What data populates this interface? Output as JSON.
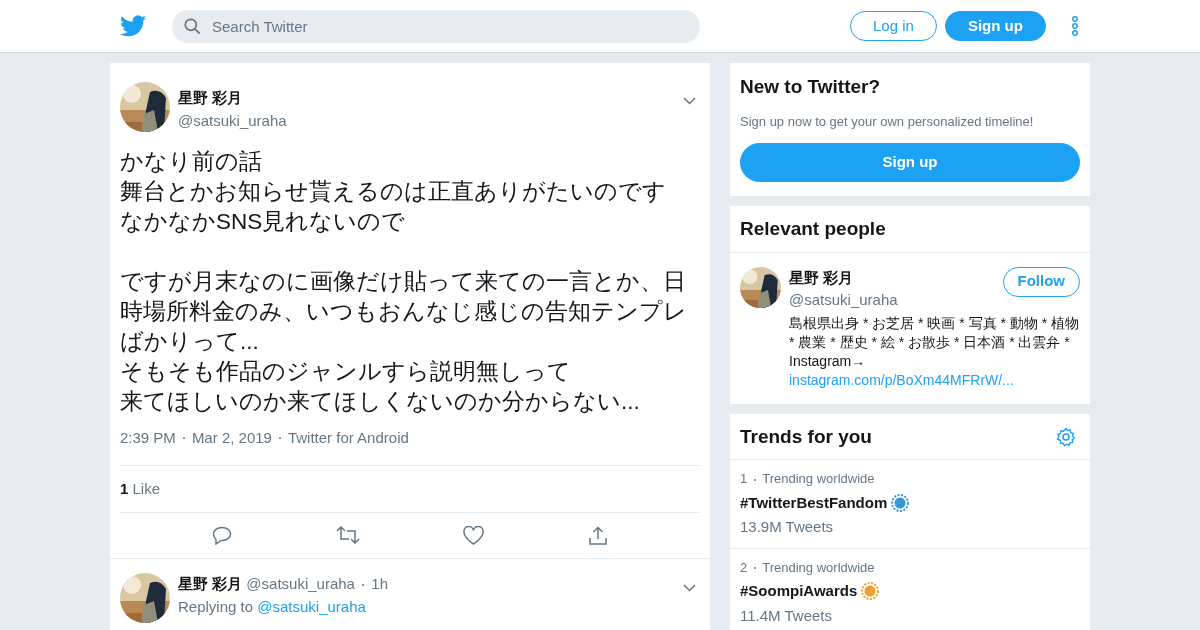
{
  "header": {
    "search": {
      "placeholder": "Search Twitter"
    },
    "buttons": [
      {
        "label": "Log in",
        "kind": "outline"
      },
      {
        "label": "Sign up",
        "kind": "solid"
      }
    ]
  },
  "tweet": {
    "name": "星野 彩月",
    "handle": "@satsuki_uraha",
    "paragraphs": [
      {
        "lines": [
          "かなり前の話",
          "舞台とかお知らせ貰えるのは正直ありがたいのです",
          "なかなかSNS見れないので"
        ]
      },
      {
        "lines": [
          "ですが月末なのに画像だけ貼って来ての一言とか、日",
          "時場所料金のみ、いつもおんなじ感じの告知テンプレ",
          "ばかりって...",
          "そもそも作品のジャンルすら説明無しって",
          "来てほしいのか来てほしくないのか分からない..."
        ]
      }
    ],
    "meta": [
      "2:39 PM",
      "Mar 2, 2019",
      "Twitter for Android"
    ],
    "likes_count": "1",
    "likes_label": "Like",
    "liked": false
  },
  "reply": {
    "name": "星野 彩月",
    "handle": "@satsuki_uraha",
    "time": "1h",
    "replying_label": "Replying to",
    "replying_to": "@satsuki_uraha"
  },
  "signup_card": {
    "title": "New to Twitter?",
    "text": "Sign up now to get your own personalized timeline!",
    "button": "Sign up"
  },
  "relevant_people": {
    "title": "Relevant people",
    "people": [
      {
        "name": "星野 彩月",
        "handle": "@satsuki_uraha",
        "button": "Follow",
        "bio": "島根県出身 * お芝居 * 映画 * 写真 * 動物 * 植物 * 農業 * 歴史 * 絵 * お散歩 * 日本酒 * 出雲弁 * Instagram→",
        "link": "instagram.com/p/BoXm44MFRrW/..."
      }
    ]
  },
  "trends": {
    "title": "Trends for you",
    "items": [
      {
        "rank": "1",
        "context": "Trending worldwide",
        "tag": "#TwitterBestFandom",
        "count": "13.9M Tweets",
        "color": "#3b94d9"
      },
      {
        "rank": "2",
        "context": "Trending worldwide",
        "tag": "#SoompiAwards",
        "count": "11.4M Tweets",
        "color": "#f0a030"
      }
    ]
  }
}
